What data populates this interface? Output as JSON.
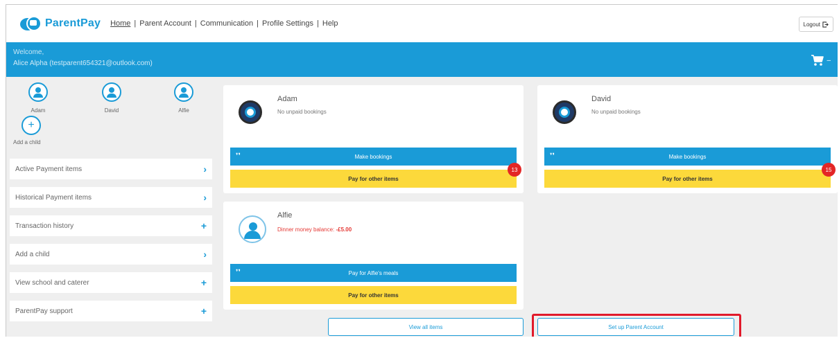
{
  "header": {
    "brand": "ParentPay",
    "nav": [
      {
        "label": "Home",
        "active": true
      },
      {
        "label": "Parent Account",
        "active": false
      },
      {
        "label": "Communication",
        "active": false
      },
      {
        "label": "Profile Settings",
        "active": false
      },
      {
        "label": "Help",
        "active": false
      }
    ],
    "logout_label": "Logout",
    "logout_icon": "logout-icon"
  },
  "welcome": {
    "greeting": "Welcome,",
    "user": "Alice Alpha (testparent654321@outlook.com)",
    "cart_icon": "cart-icon",
    "cart_caret": "–"
  },
  "children": {
    "items": [
      {
        "name": "Adam"
      },
      {
        "name": "David"
      },
      {
        "name": "Alfie"
      }
    ],
    "add_label": "Add a child"
  },
  "sidebar": {
    "items": [
      {
        "label": "Active Payment items",
        "icon": "chevron-right-icon",
        "glyph": "›"
      },
      {
        "label": "Historical Payment items",
        "icon": "chevron-right-icon",
        "glyph": "›"
      },
      {
        "label": "Transaction history",
        "icon": "plus-icon",
        "glyph": "+"
      },
      {
        "label": "Add a child",
        "icon": "chevron-right-icon",
        "glyph": "›"
      },
      {
        "label": "View school and caterer",
        "icon": "plus-icon",
        "glyph": "+"
      },
      {
        "label": "ParentPay support",
        "icon": "plus-icon",
        "glyph": "+"
      }
    ]
  },
  "cards": {
    "adam": {
      "name": "Adam",
      "status": "No unpaid bookings",
      "primary_button": "Make bookings",
      "secondary_button": "Pay for other items",
      "count": "13"
    },
    "david": {
      "name": "David",
      "status": "No unpaid bookings",
      "primary_button": "Make bookings",
      "secondary_button": "Pay for other items",
      "count": "15"
    },
    "alfie": {
      "name": "Alfie",
      "status_label": "Dinner money balance:",
      "status_value": "-£5.00",
      "primary_button": "Pay for Alfie's meals",
      "secondary_button": "Pay for other items"
    }
  },
  "footer": {
    "view_all": "View all items",
    "setup": "Set up Parent Account"
  },
  "colors": {
    "brand_blue": "#1a9bd7",
    "yellow": "#fcd93b",
    "alert_red": "#e32626",
    "highlight_red": "#e11a2b"
  }
}
